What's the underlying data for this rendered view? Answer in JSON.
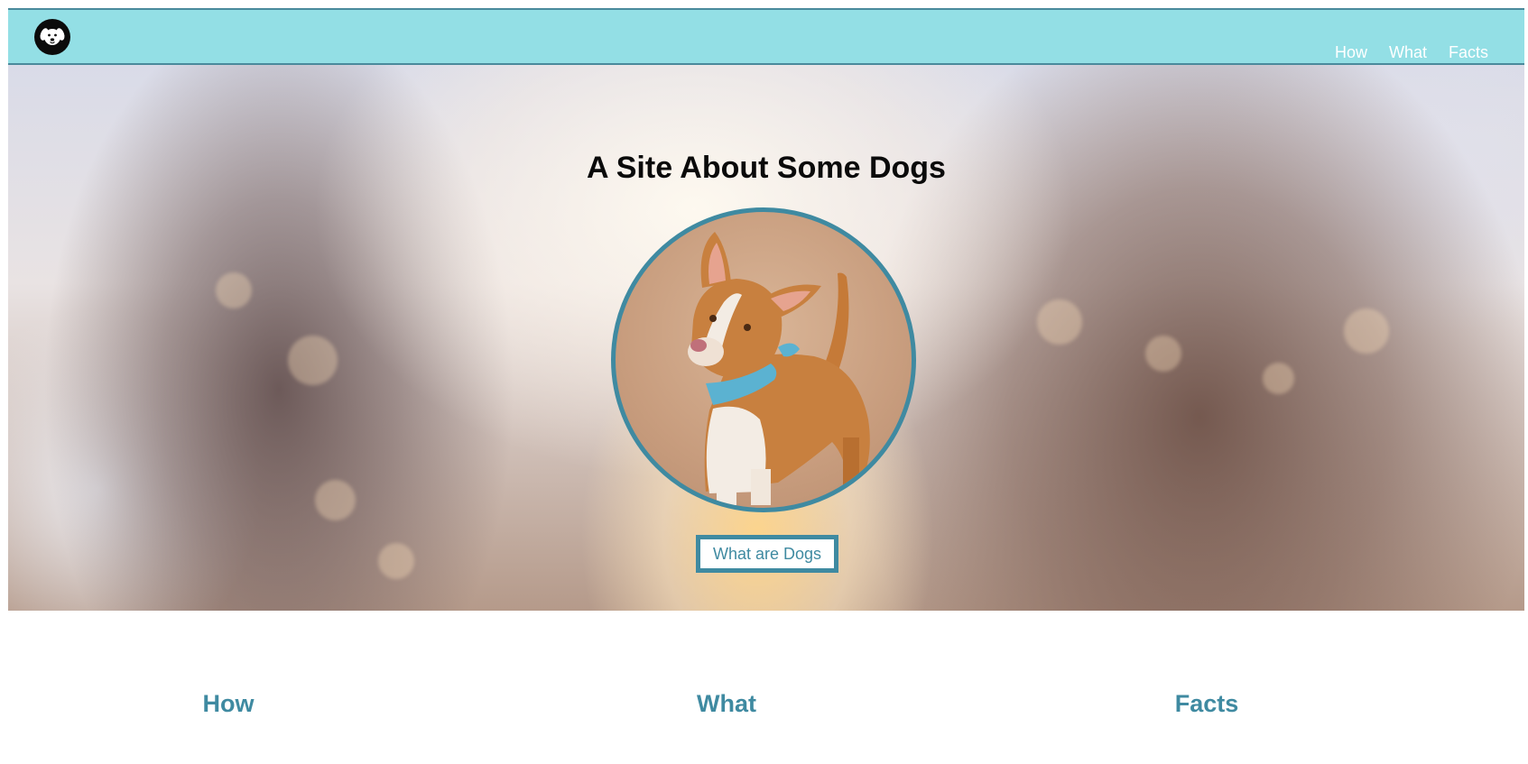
{
  "header": {
    "logo_icon": "dog-face-icon",
    "nav": [
      {
        "label": "How"
      },
      {
        "label": "What"
      },
      {
        "label": "Facts"
      }
    ]
  },
  "hero": {
    "title": "A Site About Some Dogs",
    "image_alt": "dog",
    "cta_label": "What are Dogs"
  },
  "sections": [
    {
      "heading": "How"
    },
    {
      "heading": "What"
    },
    {
      "heading": "Facts"
    }
  ],
  "colors": {
    "header_bg": "#93dfe5",
    "accent": "#3f8aa1",
    "title_text": "#0a0a0a"
  }
}
